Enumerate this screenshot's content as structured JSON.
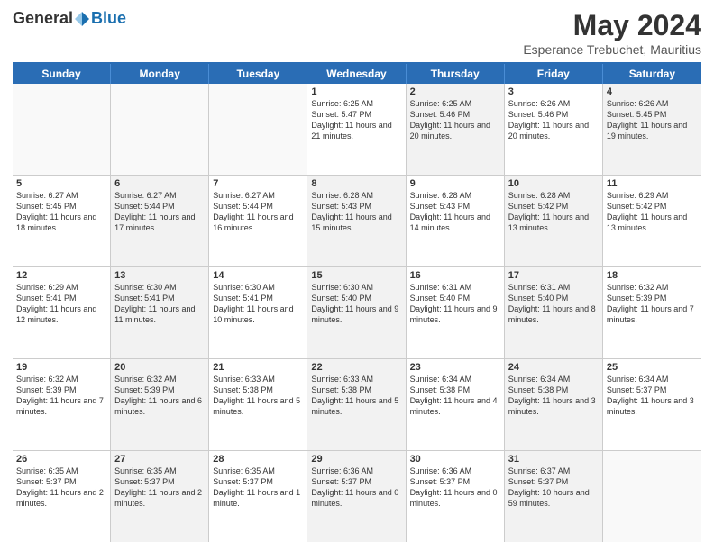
{
  "logo": {
    "general": "General",
    "blue": "Blue"
  },
  "title": {
    "month_year": "May 2024",
    "location": "Esperance Trebuchet, Mauritius"
  },
  "weekdays": [
    "Sunday",
    "Monday",
    "Tuesday",
    "Wednesday",
    "Thursday",
    "Friday",
    "Saturday"
  ],
  "rows": [
    [
      {
        "day": "",
        "info": "",
        "shade": false,
        "empty": true
      },
      {
        "day": "",
        "info": "",
        "shade": false,
        "empty": true
      },
      {
        "day": "",
        "info": "",
        "shade": false,
        "empty": true
      },
      {
        "day": "1",
        "info": "Sunrise: 6:25 AM\nSunset: 5:47 PM\nDaylight: 11 hours and 21 minutes.",
        "shade": false,
        "empty": false
      },
      {
        "day": "2",
        "info": "Sunrise: 6:25 AM\nSunset: 5:46 PM\nDaylight: 11 hours and 20 minutes.",
        "shade": true,
        "empty": false
      },
      {
        "day": "3",
        "info": "Sunrise: 6:26 AM\nSunset: 5:46 PM\nDaylight: 11 hours and 20 minutes.",
        "shade": false,
        "empty": false
      },
      {
        "day": "4",
        "info": "Sunrise: 6:26 AM\nSunset: 5:45 PM\nDaylight: 11 hours and 19 minutes.",
        "shade": true,
        "empty": false
      }
    ],
    [
      {
        "day": "5",
        "info": "Sunrise: 6:27 AM\nSunset: 5:45 PM\nDaylight: 11 hours and 18 minutes.",
        "shade": false,
        "empty": false
      },
      {
        "day": "6",
        "info": "Sunrise: 6:27 AM\nSunset: 5:44 PM\nDaylight: 11 hours and 17 minutes.",
        "shade": true,
        "empty": false
      },
      {
        "day": "7",
        "info": "Sunrise: 6:27 AM\nSunset: 5:44 PM\nDaylight: 11 hours and 16 minutes.",
        "shade": false,
        "empty": false
      },
      {
        "day": "8",
        "info": "Sunrise: 6:28 AM\nSunset: 5:43 PM\nDaylight: 11 hours and 15 minutes.",
        "shade": true,
        "empty": false
      },
      {
        "day": "9",
        "info": "Sunrise: 6:28 AM\nSunset: 5:43 PM\nDaylight: 11 hours and 14 minutes.",
        "shade": false,
        "empty": false
      },
      {
        "day": "10",
        "info": "Sunrise: 6:28 AM\nSunset: 5:42 PM\nDaylight: 11 hours and 13 minutes.",
        "shade": true,
        "empty": false
      },
      {
        "day": "11",
        "info": "Sunrise: 6:29 AM\nSunset: 5:42 PM\nDaylight: 11 hours and 13 minutes.",
        "shade": false,
        "empty": false
      }
    ],
    [
      {
        "day": "12",
        "info": "Sunrise: 6:29 AM\nSunset: 5:41 PM\nDaylight: 11 hours and 12 minutes.",
        "shade": false,
        "empty": false
      },
      {
        "day": "13",
        "info": "Sunrise: 6:30 AM\nSunset: 5:41 PM\nDaylight: 11 hours and 11 minutes.",
        "shade": true,
        "empty": false
      },
      {
        "day": "14",
        "info": "Sunrise: 6:30 AM\nSunset: 5:41 PM\nDaylight: 11 hours and 10 minutes.",
        "shade": false,
        "empty": false
      },
      {
        "day": "15",
        "info": "Sunrise: 6:30 AM\nSunset: 5:40 PM\nDaylight: 11 hours and 9 minutes.",
        "shade": true,
        "empty": false
      },
      {
        "day": "16",
        "info": "Sunrise: 6:31 AM\nSunset: 5:40 PM\nDaylight: 11 hours and 9 minutes.",
        "shade": false,
        "empty": false
      },
      {
        "day": "17",
        "info": "Sunrise: 6:31 AM\nSunset: 5:40 PM\nDaylight: 11 hours and 8 minutes.",
        "shade": true,
        "empty": false
      },
      {
        "day": "18",
        "info": "Sunrise: 6:32 AM\nSunset: 5:39 PM\nDaylight: 11 hours and 7 minutes.",
        "shade": false,
        "empty": false
      }
    ],
    [
      {
        "day": "19",
        "info": "Sunrise: 6:32 AM\nSunset: 5:39 PM\nDaylight: 11 hours and 7 minutes.",
        "shade": false,
        "empty": false
      },
      {
        "day": "20",
        "info": "Sunrise: 6:32 AM\nSunset: 5:39 PM\nDaylight: 11 hours and 6 minutes.",
        "shade": true,
        "empty": false
      },
      {
        "day": "21",
        "info": "Sunrise: 6:33 AM\nSunset: 5:38 PM\nDaylight: 11 hours and 5 minutes.",
        "shade": false,
        "empty": false
      },
      {
        "day": "22",
        "info": "Sunrise: 6:33 AM\nSunset: 5:38 PM\nDaylight: 11 hours and 5 minutes.",
        "shade": true,
        "empty": false
      },
      {
        "day": "23",
        "info": "Sunrise: 6:34 AM\nSunset: 5:38 PM\nDaylight: 11 hours and 4 minutes.",
        "shade": false,
        "empty": false
      },
      {
        "day": "24",
        "info": "Sunrise: 6:34 AM\nSunset: 5:38 PM\nDaylight: 11 hours and 3 minutes.",
        "shade": true,
        "empty": false
      },
      {
        "day": "25",
        "info": "Sunrise: 6:34 AM\nSunset: 5:37 PM\nDaylight: 11 hours and 3 minutes.",
        "shade": false,
        "empty": false
      }
    ],
    [
      {
        "day": "26",
        "info": "Sunrise: 6:35 AM\nSunset: 5:37 PM\nDaylight: 11 hours and 2 minutes.",
        "shade": false,
        "empty": false
      },
      {
        "day": "27",
        "info": "Sunrise: 6:35 AM\nSunset: 5:37 PM\nDaylight: 11 hours and 2 minutes.",
        "shade": true,
        "empty": false
      },
      {
        "day": "28",
        "info": "Sunrise: 6:35 AM\nSunset: 5:37 PM\nDaylight: 11 hours and 1 minute.",
        "shade": false,
        "empty": false
      },
      {
        "day": "29",
        "info": "Sunrise: 6:36 AM\nSunset: 5:37 PM\nDaylight: 11 hours and 0 minutes.",
        "shade": true,
        "empty": false
      },
      {
        "day": "30",
        "info": "Sunrise: 6:36 AM\nSunset: 5:37 PM\nDaylight: 11 hours and 0 minutes.",
        "shade": false,
        "empty": false
      },
      {
        "day": "31",
        "info": "Sunrise: 6:37 AM\nSunset: 5:37 PM\nDaylight: 10 hours and 59 minutes.",
        "shade": true,
        "empty": false
      },
      {
        "day": "",
        "info": "",
        "shade": false,
        "empty": true
      }
    ]
  ]
}
